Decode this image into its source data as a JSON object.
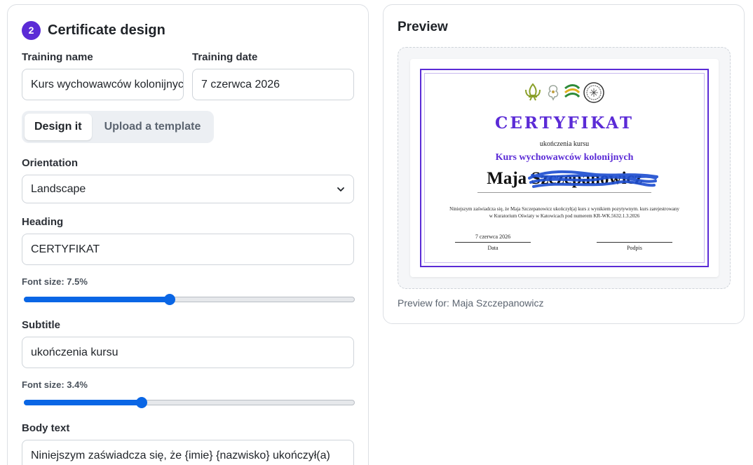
{
  "design": {
    "step_number": "2",
    "title": "Certificate design",
    "training_name_label": "Training name",
    "training_name_value": "Kurs wychowawców kolonijnych",
    "training_date_label": "Training date",
    "training_date_value": "7 czerwca 2026",
    "mode_tabs": [
      {
        "label": "Design it",
        "active": true
      },
      {
        "label": "Upload a template",
        "active": false
      }
    ],
    "orientation_label": "Orientation",
    "orientation_value": "Landscape",
    "heading_label": "Heading",
    "heading_value": "CERTYFIKAT",
    "heading_font_label": "Font size: 7.5%",
    "heading_slider_fraction": 0.44,
    "subtitle_label": "Subtitle",
    "subtitle_value": "ukończenia kursu",
    "subtitle_font_label": "Font size: 3.4%",
    "subtitle_slider_fraction": 0.355,
    "body_label": "Body text",
    "body_value": "Niniejszym zaświadcza się, że {imie} {nazwisko} ukończył(a)"
  },
  "preview": {
    "title": "Preview",
    "certificate": {
      "heading": "CERTYFIKAT",
      "subtitle": "ukończenia kursu",
      "course": "Kurs wychowawców kolonijnych",
      "name": "Maja Szczepanowicz",
      "body": "Niniejszym zaświadcza się, że Maja Szczepanowicz ukończył(a) kurs z wynikiem pozytywnym. kurs zarejestrowany w Kuratorium Oświaty w Katowicach pod numerem KR-WK.5632.1.3.2026",
      "date_value": "7 czerwca 2026",
      "date_caption": "Data",
      "signature_caption": "Podpis"
    },
    "preview_for": "Preview for: Maja Szczepanowicz"
  },
  "colors": {
    "accent": "#5b2bd6",
    "slider": "#0a66e5"
  }
}
